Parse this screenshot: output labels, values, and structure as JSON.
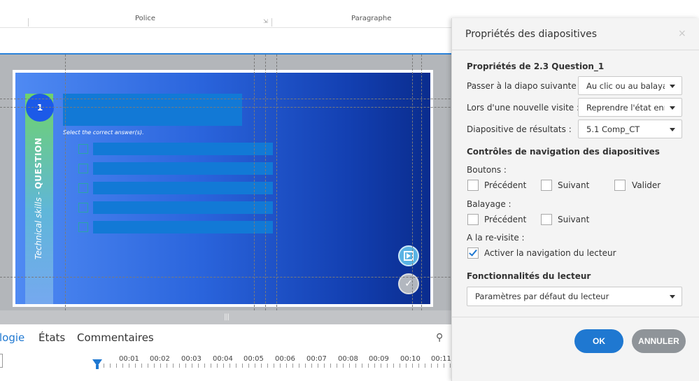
{
  "ribbon": {
    "group_font": "Police",
    "group_paragraph": "Paragraphe",
    "launcher_symbol": "⇲"
  },
  "slide": {
    "question_number": "1",
    "sidebar_text_light": "Technical skills - ",
    "sidebar_text_bold": "QUESTION",
    "instruction": "Select the correct answer(s).",
    "answer_count": 5
  },
  "bottom_tabs": {
    "tab_active": "logie",
    "tab_states": "États",
    "tab_comments": "Commentaires"
  },
  "timeline": {
    "marks": [
      "00:01",
      "00:02",
      "00:03",
      "00:04",
      "00:05",
      "00:06",
      "00:07",
      "00:08",
      "00:09",
      "00:10",
      "00:11"
    ]
  },
  "dialog": {
    "title": "Propriétés des diapositives",
    "close_symbol": "×",
    "section_properties": "Propriétés de 2.3 Question_1",
    "next_slide_label": "Passer à la diapo suivante :",
    "next_slide_value": "Au clic ou au balayage",
    "revisit_label": "Lors d'une nouvelle visite :",
    "revisit_value": "Reprendre l'état enregistré",
    "results_label": "Diapositive de résultats :",
    "results_value": "5.1 Comp_CT",
    "section_nav": "Contrôles de navigation des diapositives",
    "buttons_label": "Boutons :",
    "btn_previous": "Précédent",
    "btn_next": "Suivant",
    "btn_submit": "Valider",
    "swipe_label": "Balayage :",
    "swipe_previous": "Précédent",
    "swipe_next": "Suivant",
    "revisit_section_label": "A la re-visite :",
    "player_nav_label": "Activer la navigation du lecteur",
    "section_player": "Fonctionnalités du lecteur",
    "player_value": "Paramètres par défaut du lecteur",
    "ok_label": "OK",
    "cancel_label": "ANNULER"
  },
  "colors": {
    "accent": "#1f78d1",
    "slide_dark": "#0a2c8e",
    "slide_light": "#4f8af3",
    "answer_bar": "#1279d6",
    "cancel_gray": "#8f9499"
  }
}
